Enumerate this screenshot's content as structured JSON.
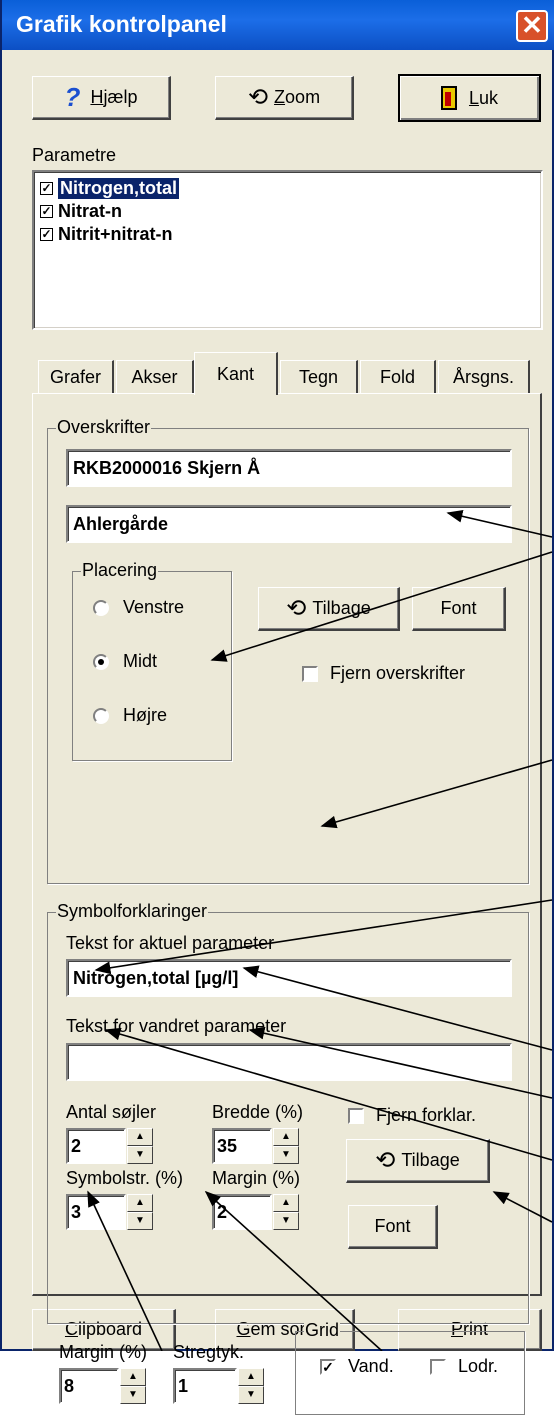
{
  "window": {
    "title": "Grafik kontrolpanel",
    "close_glyph": "✕"
  },
  "toolbar": {
    "help": "Hjælp",
    "help_u": "H",
    "zoom": "Zoom",
    "zoom_u": "Z",
    "close": "Luk",
    "close_u": "L"
  },
  "parameters": {
    "label": "Parametre",
    "items": [
      {
        "label": "Nitrogen,total",
        "checked": true,
        "selected": true
      },
      {
        "label": "Nitrat-n",
        "checked": true,
        "selected": false
      },
      {
        "label": "Nitrit+nitrat-n",
        "checked": true,
        "selected": false
      }
    ]
  },
  "tabs": [
    "Grafer",
    "Akser",
    "Kant",
    "Tegn",
    "Fold",
    "Årsgns."
  ],
  "active_tab": "Kant",
  "headings": {
    "group_label": "Overskrifter",
    "line1": "RKB2000016 Skjern Å",
    "line2": "Ahlergårde",
    "placement": {
      "label": "Placering",
      "left": "Venstre",
      "center": "Midt",
      "right": "Højre",
      "selected": "Midt"
    },
    "reset_button": "Tilbage",
    "font_button": "Font",
    "remove_label": "Fjern overskrifter",
    "remove_checked": false
  },
  "legend": {
    "group_label": "Symbolforklaringer",
    "current_label": "Tekst for aktuel parameter",
    "current_value": "Nitrogen,total [µg/l]",
    "horizontal_label": "Tekst for vandret parameter",
    "horizontal_value": "",
    "columns_label": "Antal søjler",
    "columns_value": "2",
    "width_label": "Bredde (%)",
    "width_value": "35",
    "symbol_label": "Symbolstr. (%)",
    "symbol_value": "3",
    "margin_label": "Margin (%)",
    "margin_value": "2",
    "remove_label": "Fjern forklar.",
    "remove_checked": false,
    "reset_button": "Tilbage",
    "font_button": "Font"
  },
  "frame": {
    "margin_label": "Margin (%)",
    "margin_value": "8",
    "stroke_label": "Stregtyk.",
    "stroke_value": "1",
    "grid_label": "Grid",
    "horizontal_label": "Vand.",
    "horizontal_checked": true,
    "vertical_label": "Lodr.",
    "vertical_checked": false
  },
  "bottom": {
    "clipboard": "Clipboard",
    "clipboard_u": "C",
    "save": "Gem som fil",
    "save_u": "G",
    "print": "Print",
    "print_u": "P"
  },
  "colors": {
    "title_bar": "#0a5fd8",
    "selection": "#0a246a",
    "face": "#ece9d8",
    "close": "#d8512a"
  }
}
